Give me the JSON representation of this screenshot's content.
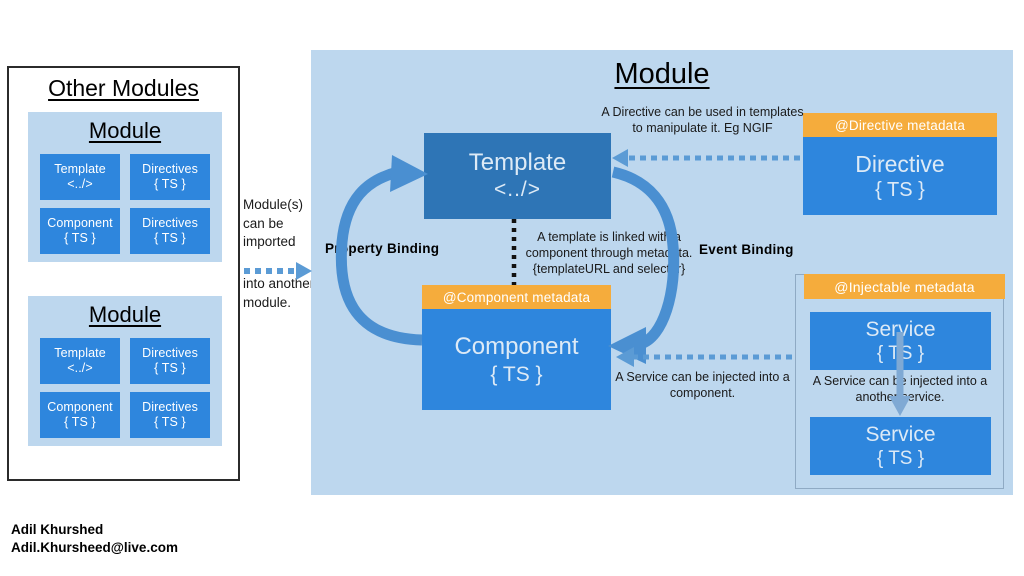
{
  "left_panel": {
    "title": "Other Modules",
    "modules": [
      {
        "title": "Module",
        "boxes": [
          {
            "line1": "Template",
            "line2": "<../>"
          },
          {
            "line1": "Directives",
            "line2": "{ TS }"
          },
          {
            "line1": "Component",
            "line2": "{ TS }"
          },
          {
            "line1": "Directives",
            "line2": "{ TS }"
          }
        ]
      },
      {
        "title": "Module",
        "boxes": [
          {
            "line1": "Template",
            "line2": "<../>"
          },
          {
            "line1": "Directives",
            "line2": "{ TS }"
          },
          {
            "line1": "Component",
            "line2": "{ TS }"
          },
          {
            "line1": "Directives",
            "line2": "{ TS }"
          }
        ]
      }
    ]
  },
  "import_note": {
    "top": "Module(s) can be imported",
    "bottom": "into another module.",
    "arrow_icon": "dashed-right-arrow-icon"
  },
  "module_panel": {
    "title": "Module",
    "template": {
      "line1": "Template",
      "line2": "<../>"
    },
    "component": {
      "metadata": "@Component metadata",
      "line1": "Component",
      "line2": "{ TS }"
    },
    "directive": {
      "metadata": "@Directive metadata",
      "line1": "Directive",
      "line2": "{ TS }"
    },
    "injectable": {
      "metadata": "@Injectable metadata",
      "services": [
        {
          "line1": "Service",
          "line2": "{ TS }"
        },
        {
          "line1": "Service",
          "line2": "{ TS }"
        }
      ]
    },
    "bindings": {
      "property": "Property  Binding",
      "event": "Event Binding"
    },
    "annotations": {
      "directive_use": "A Directive can be used in templates to manipulate it. Eg NGIF",
      "template_link": "A template is linked with a component  through  metadata. {templateURL and selector}",
      "service_into_component": "A Service can be injected into a component.",
      "service_into_service": "A Service can be injected into a another service."
    }
  },
  "footer": {
    "name": "Adil Khurshed",
    "email": "Adil.Khursheed@live.com"
  },
  "colors": {
    "panel_bg": "#BDD7EE",
    "box_blue": "#2E86DD",
    "template_blue": "#2E75B6",
    "metadata_orange": "#F5AC3C",
    "arrow_blue": "#4A8FD1",
    "dashed_blue": "#5B9BD5",
    "text_light": "#DDEAF6"
  }
}
